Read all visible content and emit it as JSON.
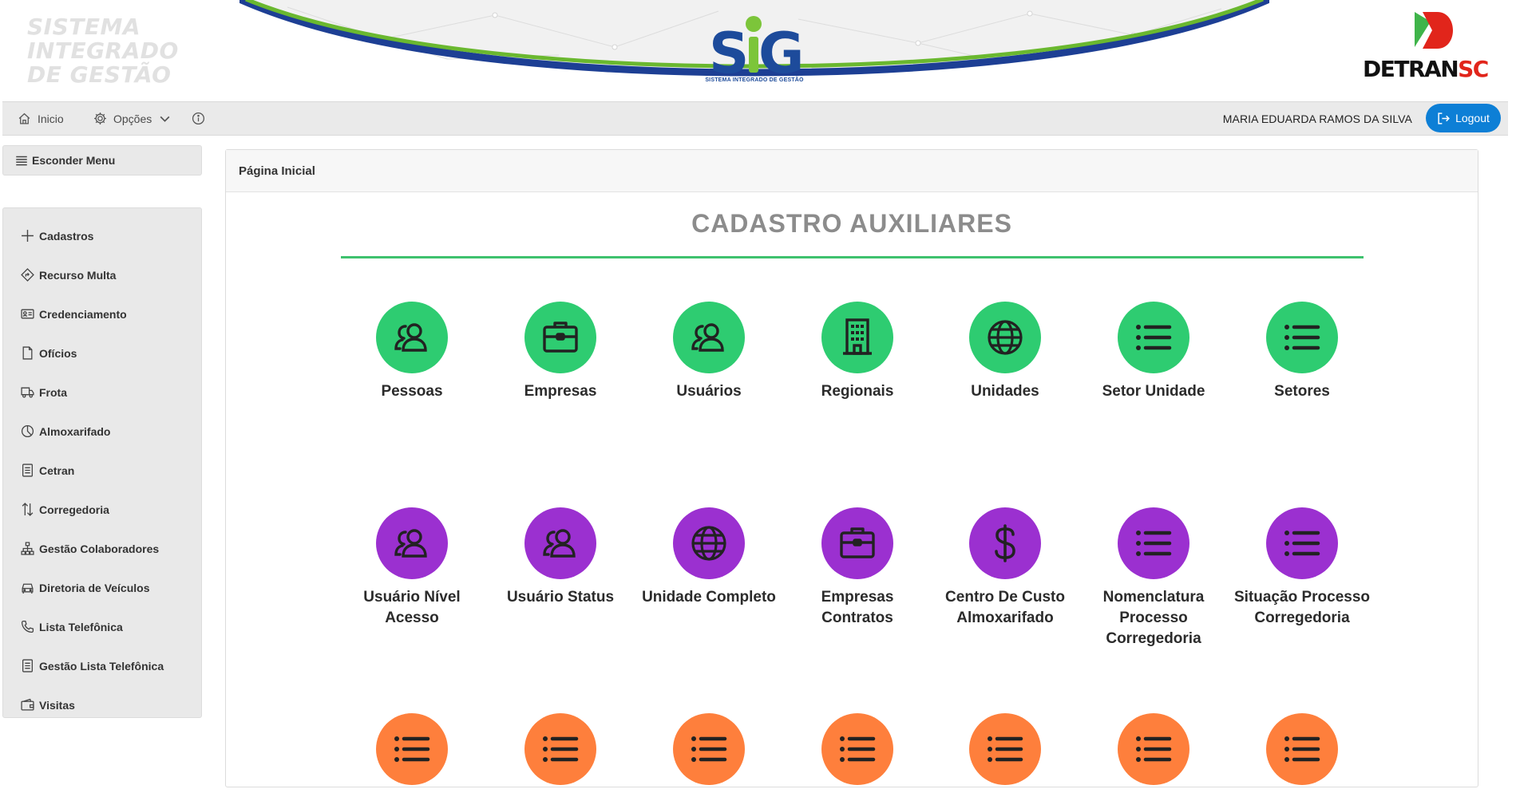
{
  "header": {
    "brand_lines": [
      "SISTEMA",
      "INTEGRADO",
      "DE GESTÃO"
    ],
    "logo_text": "SIG",
    "logo_subtitle": "SISTEMA INTEGRADO DE GESTÃO",
    "detran_main": "DETRAN",
    "detran_suffix": "SC"
  },
  "topnav": {
    "home_label": "Inicio",
    "options_label": "Opções",
    "user_name": "MARIA EDUARDA RAMOS DA SILVA",
    "logout_label": "Logout"
  },
  "sidebar": {
    "hide_menu_label": "Esconder Menu",
    "items": [
      {
        "label": "Cadastros",
        "icon": "plus-icon"
      },
      {
        "label": "Recurso Multa",
        "icon": "signpost-icon"
      },
      {
        "label": "Credenciamento",
        "icon": "person-badge-icon"
      },
      {
        "label": "Ofícios",
        "icon": "file-icon"
      },
      {
        "label": "Frota",
        "icon": "truck-icon"
      },
      {
        "label": "Almoxarifado",
        "icon": "pie-chart-icon"
      },
      {
        "label": "Cetran",
        "icon": "document-icon"
      },
      {
        "label": "Corregedoria",
        "icon": "arrows-vertical-icon"
      },
      {
        "label": "Gestão Colaboradores",
        "icon": "org-chart-icon"
      },
      {
        "label": "Diretoria de Veículos",
        "icon": "car-icon"
      },
      {
        "label": "Lista Telefônica",
        "icon": "phone-icon"
      },
      {
        "label": "Gestão Lista Telefônica",
        "icon": "document-icon"
      },
      {
        "label": "Visitas",
        "icon": "wallet-icon"
      }
    ]
  },
  "main": {
    "breadcrumb": "Página Inicial",
    "section_title": "CADASTRO AUXILIARES",
    "colors": {
      "green": "#2ecc71",
      "purple": "#9b30d0",
      "orange": "#fe7f3c",
      "rule": "#3fc26e"
    },
    "rows": [
      {
        "color": "green",
        "tiles": [
          {
            "label": "Pessoas",
            "icon": "people-icon"
          },
          {
            "label": "Empresas",
            "icon": "briefcase-icon"
          },
          {
            "label": "Usuários",
            "icon": "people-icon"
          },
          {
            "label": "Regionais",
            "icon": "building-icon"
          },
          {
            "label": "Unidades",
            "icon": "globe-icon"
          },
          {
            "label": "Setor Unidade",
            "icon": "list-icon"
          },
          {
            "label": "Setores",
            "icon": "list-icon"
          }
        ]
      },
      {
        "color": "purple",
        "tiles": [
          {
            "label": "Usuário Nível Acesso",
            "icon": "people-icon"
          },
          {
            "label": "Usuário Status",
            "icon": "people-icon"
          },
          {
            "label": "Unidade Completo",
            "icon": "globe-icon"
          },
          {
            "label": "Empresas Contratos",
            "icon": "briefcase-icon"
          },
          {
            "label": "Centro De Custo Almoxarifado",
            "icon": "dollar-icon"
          },
          {
            "label": "Nomenclatura Processo Corregedoria",
            "icon": "list-icon"
          },
          {
            "label": "Situação Processo Corregedoria",
            "icon": "list-icon"
          }
        ]
      },
      {
        "color": "orange",
        "tiles": [
          {
            "label": "",
            "icon": "list-icon"
          },
          {
            "label": "",
            "icon": "list-icon"
          },
          {
            "label": "",
            "icon": "list-icon"
          },
          {
            "label": "",
            "icon": "list-icon"
          },
          {
            "label": "",
            "icon": "list-icon"
          },
          {
            "label": "",
            "icon": "list-icon"
          },
          {
            "label": "",
            "icon": "list-icon"
          }
        ]
      }
    ]
  }
}
